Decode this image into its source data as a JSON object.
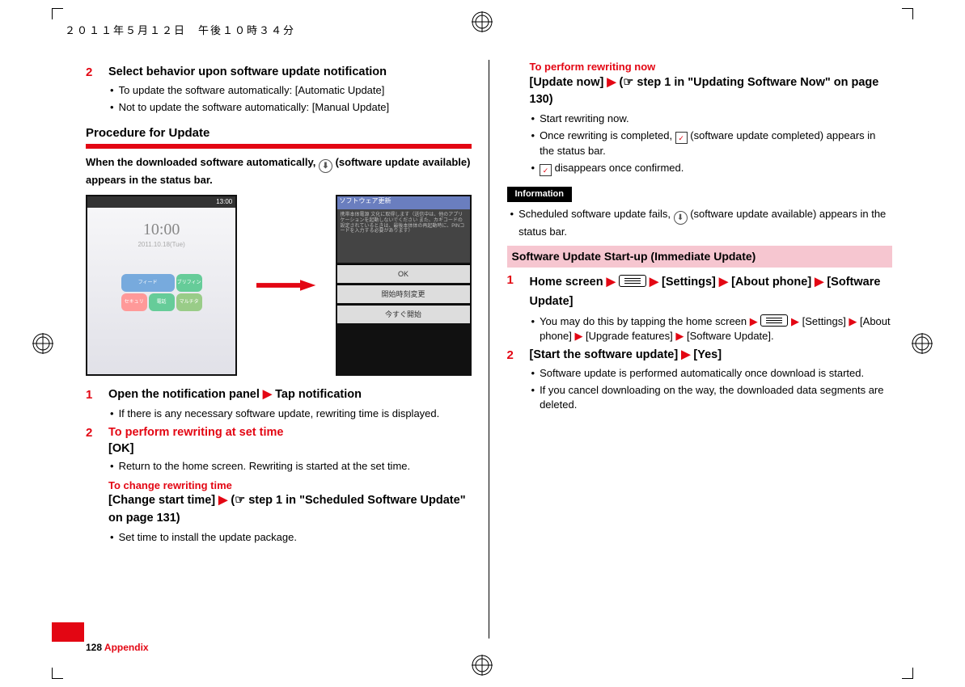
{
  "header_date": "２０１１年５月１２日　午後１０時３４分",
  "left": {
    "step2_title": "Select behavior upon software update notification",
    "step2_b1": "To update the software automatically: [Automatic Update]",
    "step2_b2": "Not to update the software automatically: [Manual Update]",
    "proc_title": "Procedure for Update",
    "proc_lead_a": "When the downloaded software automatically, ",
    "proc_lead_b": " (software update available) appears in the status bar.",
    "fig": {
      "status_time": "13:00",
      "clock": "10:00",
      "datej": "2011.10.18(Tue)",
      "w_feed": "フィード",
      "w_brief": "ブリフィン",
      "w_set": "セキュリ",
      "w_phone": "電話",
      "w_multi": "マルチタ",
      "dlg_title": "ソフトウェア更新",
      "dlg_text": "携帯本体電源 文化に取得します（送信中は、他のアプリケーションを起動しないでください また、カギコードの設定されているときは、最後本体体の再起動時に、PINコードを入力する必要があります）",
      "btn_ok": "OK",
      "btn_change": "開始時刻変更",
      "btn_now": "今すぐ開始"
    },
    "step1_open": "Open the notification panel ",
    "step1_open_b": " Tap notification",
    "step1_b1": "If there is any necessary software update, rewriting time is displayed.",
    "step2b_red": "To perform rewriting at set time",
    "step2b_ok": "[OK]",
    "step2b_b1": "Return to the home screen. Rewriting is started at the set time.",
    "step2b_red2": "To change rewriting time",
    "step2b_change_a": "[Change start time] ",
    "step2b_change_b": " (",
    "step2b_change_c": " step 1 in \"Scheduled Software Update\" on page 131)",
    "step2b_b2": "Set time to install the update package."
  },
  "right": {
    "red_now": "To perform rewriting now",
    "now_a": "[Update now] ",
    "now_b": " (",
    "now_c": " step 1 in \"Updating Software Now\" on page 130)",
    "b1": "Start rewriting now.",
    "b2a": "Once rewriting is completed, ",
    "b2b": " (software update completed) appears in the status bar.",
    "b3a": "",
    "b3b": " disappears once confirmed.",
    "info_label": "Information",
    "info_b_a": "Scheduled software update fails, ",
    "info_b_b": " (software update available) appears in the status bar.",
    "section": "Software Update Start-up (Immediate Update)",
    "s1_a": "Home screen ",
    "s1_b": " [Settings] ",
    "s1_c": " [About phone] ",
    "s1_d": " [Software Update]",
    "s1_bul_a": "You may do this by tapping the home screen ",
    "s1_bul_b": " [Settings] ",
    "s1_bul_c": " [About phone] ",
    "s1_bul_d": " [Upgrade features] ",
    "s1_bul_e": " [Software Update].",
    "s2": "[Start the software update] ",
    "s2b": " [Yes]",
    "s2_bul1": "Software update is performed automatically once download is started.",
    "s2_bul2": "If you cancel downloading on the way, the downloaded data segments are deleted."
  },
  "footer": {
    "page": "128",
    "section": "Appendix"
  },
  "glyph": {
    "tri": "▶",
    "hand": "☞",
    "down": "⬇",
    "check": "✓"
  }
}
